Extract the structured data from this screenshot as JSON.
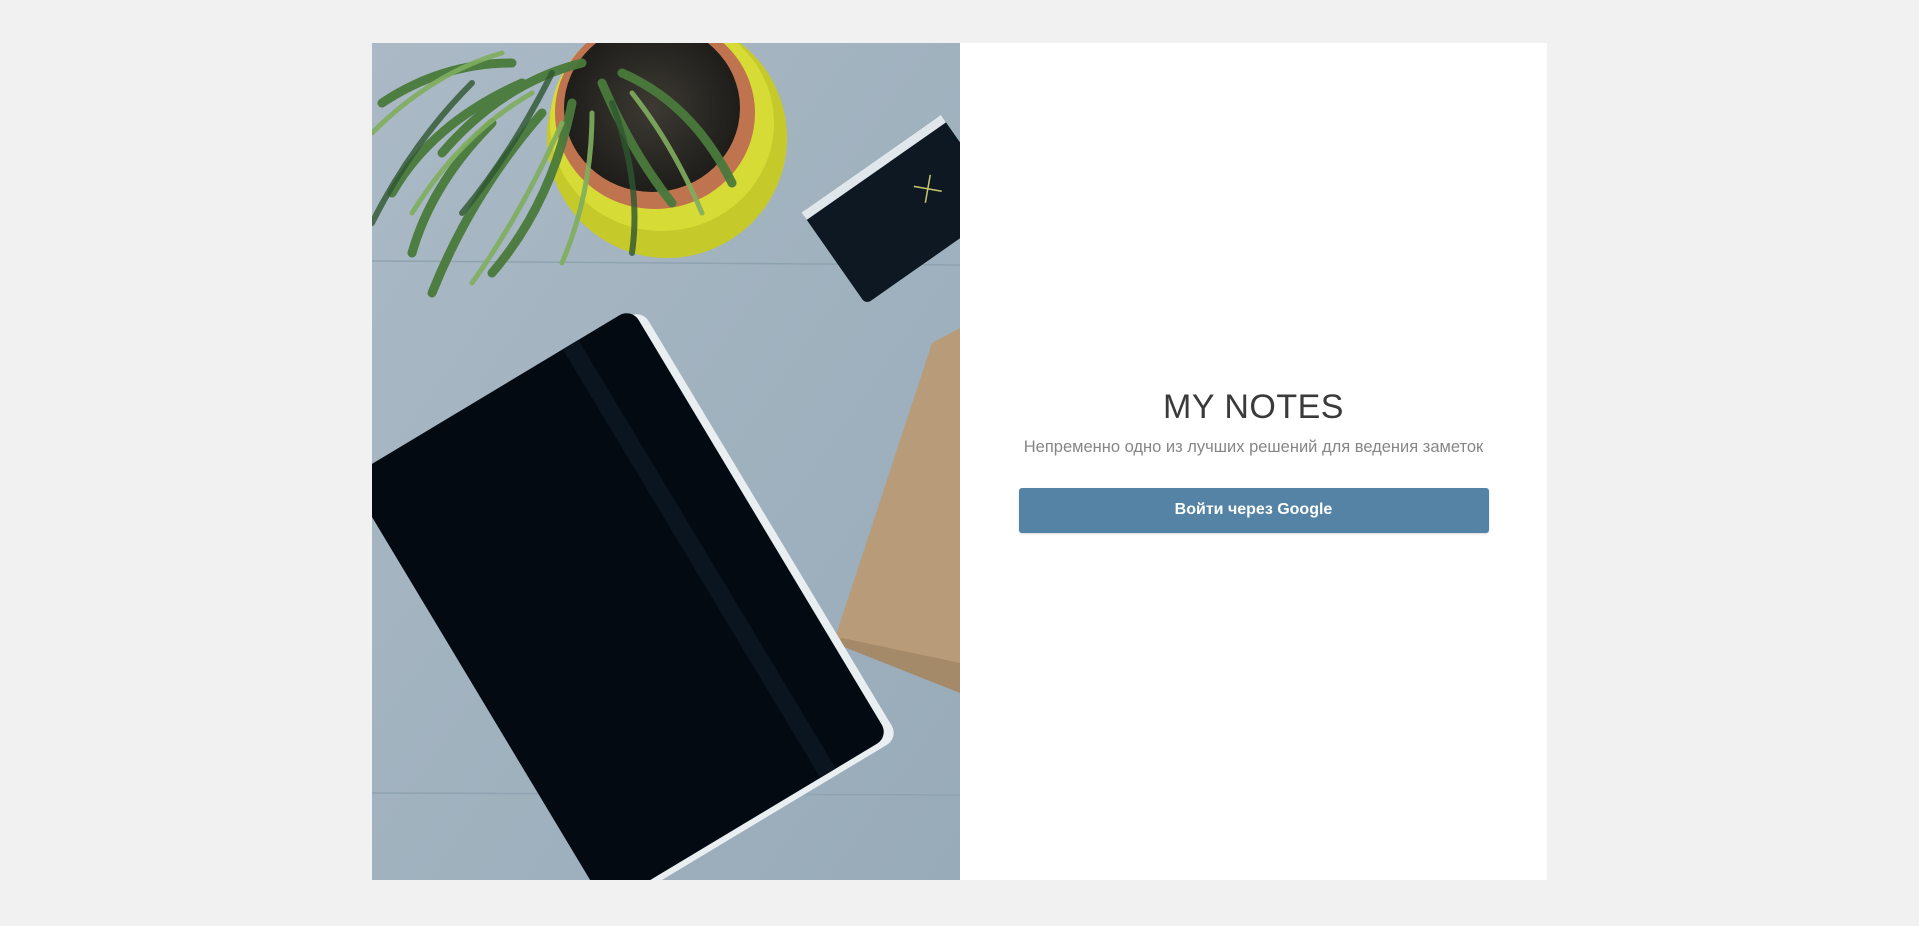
{
  "app": {
    "title": "MY NOTES",
    "tagline": "Непременно одно из лучших решений для ведения заметок"
  },
  "login": {
    "google_button_label": "Войти через Google"
  },
  "hero_image": {
    "description_icon": "desk-photo"
  },
  "colors": {
    "page_background": "#f1f1f1",
    "panel_background": "#ffffff",
    "button_background": "#5483a5",
    "button_text": "#ffffff",
    "title_text": "#3a3a3a",
    "tagline_text": "#868686"
  }
}
